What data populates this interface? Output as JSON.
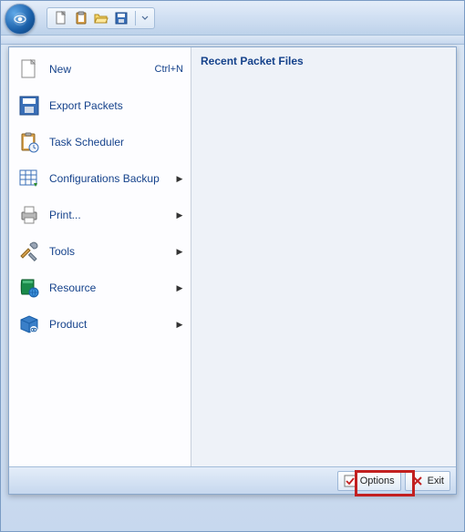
{
  "menu": {
    "items": [
      {
        "label": "New",
        "shortcut": "Ctrl+N",
        "has_sub": false,
        "icon": "new"
      },
      {
        "label": "Export Packets",
        "shortcut": "",
        "has_sub": false,
        "icon": "export"
      },
      {
        "label": "Task Scheduler",
        "shortcut": "",
        "has_sub": false,
        "icon": "scheduler"
      },
      {
        "label": "Configurations Backup",
        "shortcut": "",
        "has_sub": true,
        "icon": "backup"
      },
      {
        "label": "Print...",
        "shortcut": "",
        "has_sub": true,
        "icon": "print"
      },
      {
        "label": "Tools",
        "shortcut": "",
        "has_sub": true,
        "icon": "tools"
      },
      {
        "label": "Resource",
        "shortcut": "",
        "has_sub": true,
        "icon": "resource"
      },
      {
        "label": "Product",
        "shortcut": "",
        "has_sub": true,
        "icon": "product"
      }
    ]
  },
  "recent": {
    "title": "Recent Packet Files"
  },
  "footer": {
    "options": "Options",
    "exit": "Exit"
  },
  "highlight": "options-button"
}
